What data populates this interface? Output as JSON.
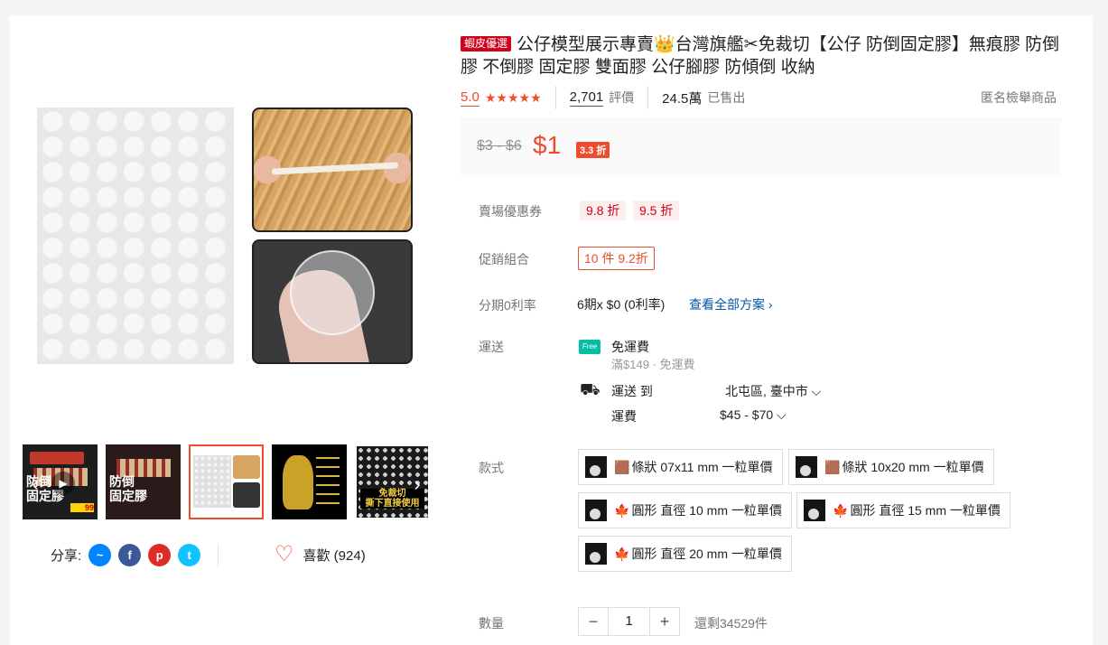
{
  "colors": {
    "accent": "#ee4d2d",
    "mall": "#d0011b",
    "free_ship": "#00bfa5",
    "link": "#0055aa"
  },
  "gallery": {
    "thumbnails": [
      {
        "banner": "防倒\n固定膠",
        "sticker": "99"
      },
      {
        "banner": "防倒\n固定膠"
      },
      {
        "banner": ""
      },
      {
        "banner": ""
      },
      {
        "banner": "免裁切\n撕下直接使用"
      }
    ]
  },
  "share": {
    "label": "分享:",
    "icons": [
      "messenger-icon",
      "facebook-icon",
      "pinterest-icon",
      "twitter-icon"
    ]
  },
  "like": {
    "label": "喜歡 (924)"
  },
  "product": {
    "mall_badge": "蝦皮優選",
    "title": "公仔模型展示專賣👑台灣旗艦✂免裁切【公仔 防倒固定膠】無痕膠 防倒膠 不倒膠 固定膠 雙面膠 公仔腳膠 防傾倒 收納",
    "rating": "5.0",
    "stars": "★★★★★",
    "reviews_count": "2,701",
    "reviews_label": "評價",
    "sold_count": "24.5萬",
    "sold_label": "已售出",
    "report": "匿名檢舉商品"
  },
  "price": {
    "original": "$3 - $6",
    "current": "$1",
    "discount": "3.3 折"
  },
  "vouchers": {
    "label": "賣場優惠券",
    "items": [
      "9.8 折",
      "9.5 折"
    ]
  },
  "combo": {
    "label": "促銷組合",
    "value": "10 件 9.2折"
  },
  "installment": {
    "label": "分期0利率",
    "value": "6期x $0 (0利率)",
    "link": "查看全部方案 ›"
  },
  "shipping": {
    "label": "運送",
    "free_badge": "Free",
    "free_title": "免運費",
    "free_sub": "滿$149 · 免運費",
    "to_label": "運送 到",
    "location": "北屯區, 臺中市 ⌵",
    "fee_label": "運費",
    "fee_value": "$45 - $70 ⌵"
  },
  "variations": {
    "label": "款式",
    "options": [
      {
        "icon": "🟫",
        "text": "條狀 07x11 mm 一粒單價"
      },
      {
        "icon": "🟫",
        "text": "條狀 10x20 mm 一粒單價"
      },
      {
        "icon": "🍁",
        "text": "圓形 直徑 10 mm 一粒單價"
      },
      {
        "icon": "🍁",
        "text": "圓形 直徑 15 mm 一粒單價"
      },
      {
        "icon": "🍁",
        "text": "圓形 直徑 20 mm 一粒單價"
      }
    ]
  },
  "quantity": {
    "label": "數量",
    "minus": "−",
    "value": "1",
    "plus": "+",
    "stock": "還剩34529件"
  }
}
